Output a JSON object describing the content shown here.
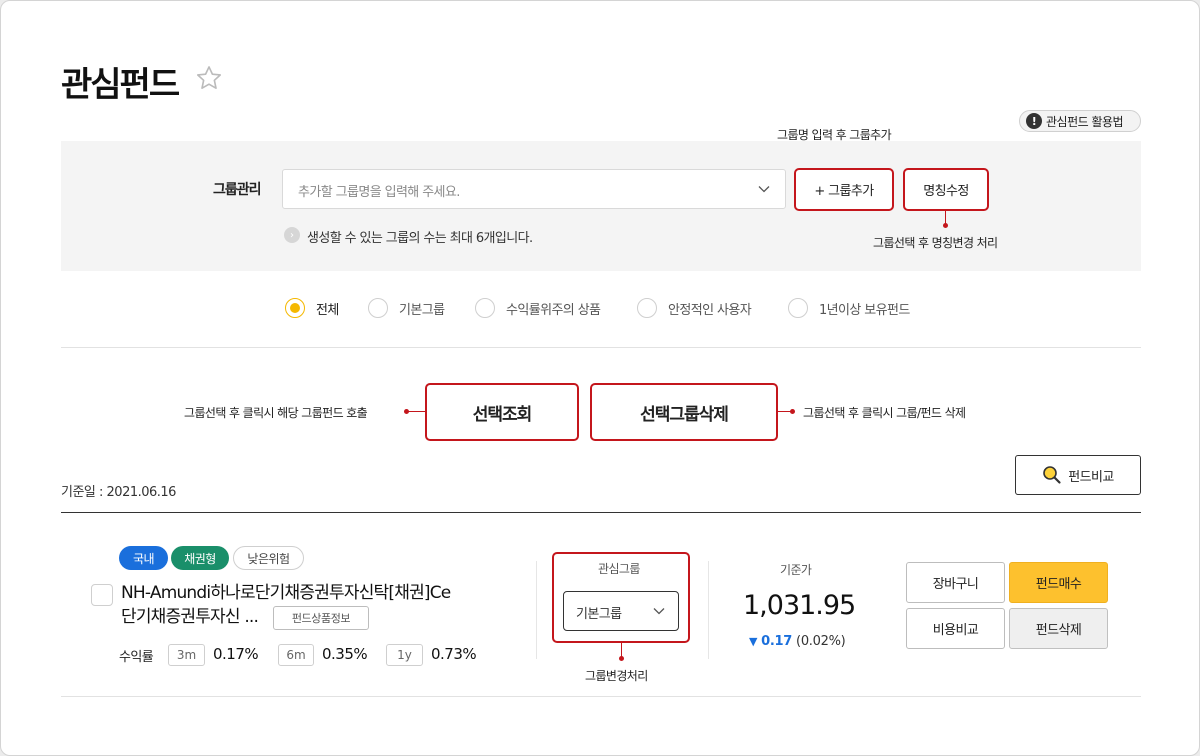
{
  "page": {
    "title": "관심펀드",
    "help_button": "관심펀드 활용법"
  },
  "group_mgmt": {
    "label": "그룹관리",
    "input_placeholder": "추가할 그룹명을 입력해 주세요.",
    "add_button": "+ 그룹추가",
    "rename_button": "명칭수정",
    "info_text": "생성할 수 있는 그룹의 수는 최대 6개입니다."
  },
  "annotations": {
    "add_group": "그룹명 입력 후 그룹추가",
    "rename": "그룹선택 후 명칭변경 처리",
    "select_query": "그룹선택 후 클릭시 해당 그룹펀드 호출",
    "select_delete": "그룹선택 후 클릭시 그룹/펀드 삭제",
    "change_group": "그룹변경처리"
  },
  "filters": [
    {
      "label": "전체",
      "selected": true
    },
    {
      "label": "기본그룹",
      "selected": false
    },
    {
      "label": "수익률위주의 상품",
      "selected": false
    },
    {
      "label": "안정적인 사용자",
      "selected": false
    },
    {
      "label": "1년이상 보유펀드",
      "selected": false
    }
  ],
  "actions": {
    "select_query": "선택조회",
    "select_delete": "선택그룹삭제"
  },
  "base_date": "기준일 : 2021.06.16",
  "compare_button": "펀드비교",
  "fund": {
    "tags": [
      "국내",
      "채권형",
      "낮은위험"
    ],
    "name_line1": "NH-Amundi하나로단기채증권투자신탁[채권]Ce",
    "name_line2": "단기채증권투자신 ...",
    "info_button": "펀드상품정보",
    "return_label": "수익률",
    "returns": [
      {
        "period": "3m",
        "value": "0.17%"
      },
      {
        "period": "6m",
        "value": "0.35%"
      },
      {
        "period": "1y",
        "value": "0.73%"
      }
    ],
    "watch_group_label": "관심그룹",
    "watch_group_value": "기본그룹",
    "price_label": "기준가",
    "price": "1,031.95",
    "change_value": "0.17",
    "change_pct": "(0.02%)",
    "buttons": {
      "cart": "장바구니",
      "buy": "펀드매수",
      "cost_compare": "비용비교",
      "delete": "펀드삭제"
    }
  },
  "colors": {
    "accent_red": "#c4161c",
    "accent_yellow": "#fdc12e",
    "tag_blue": "#1a6fdc",
    "tag_green": "#1a8f6a",
    "down_blue": "#1a6fdc"
  }
}
